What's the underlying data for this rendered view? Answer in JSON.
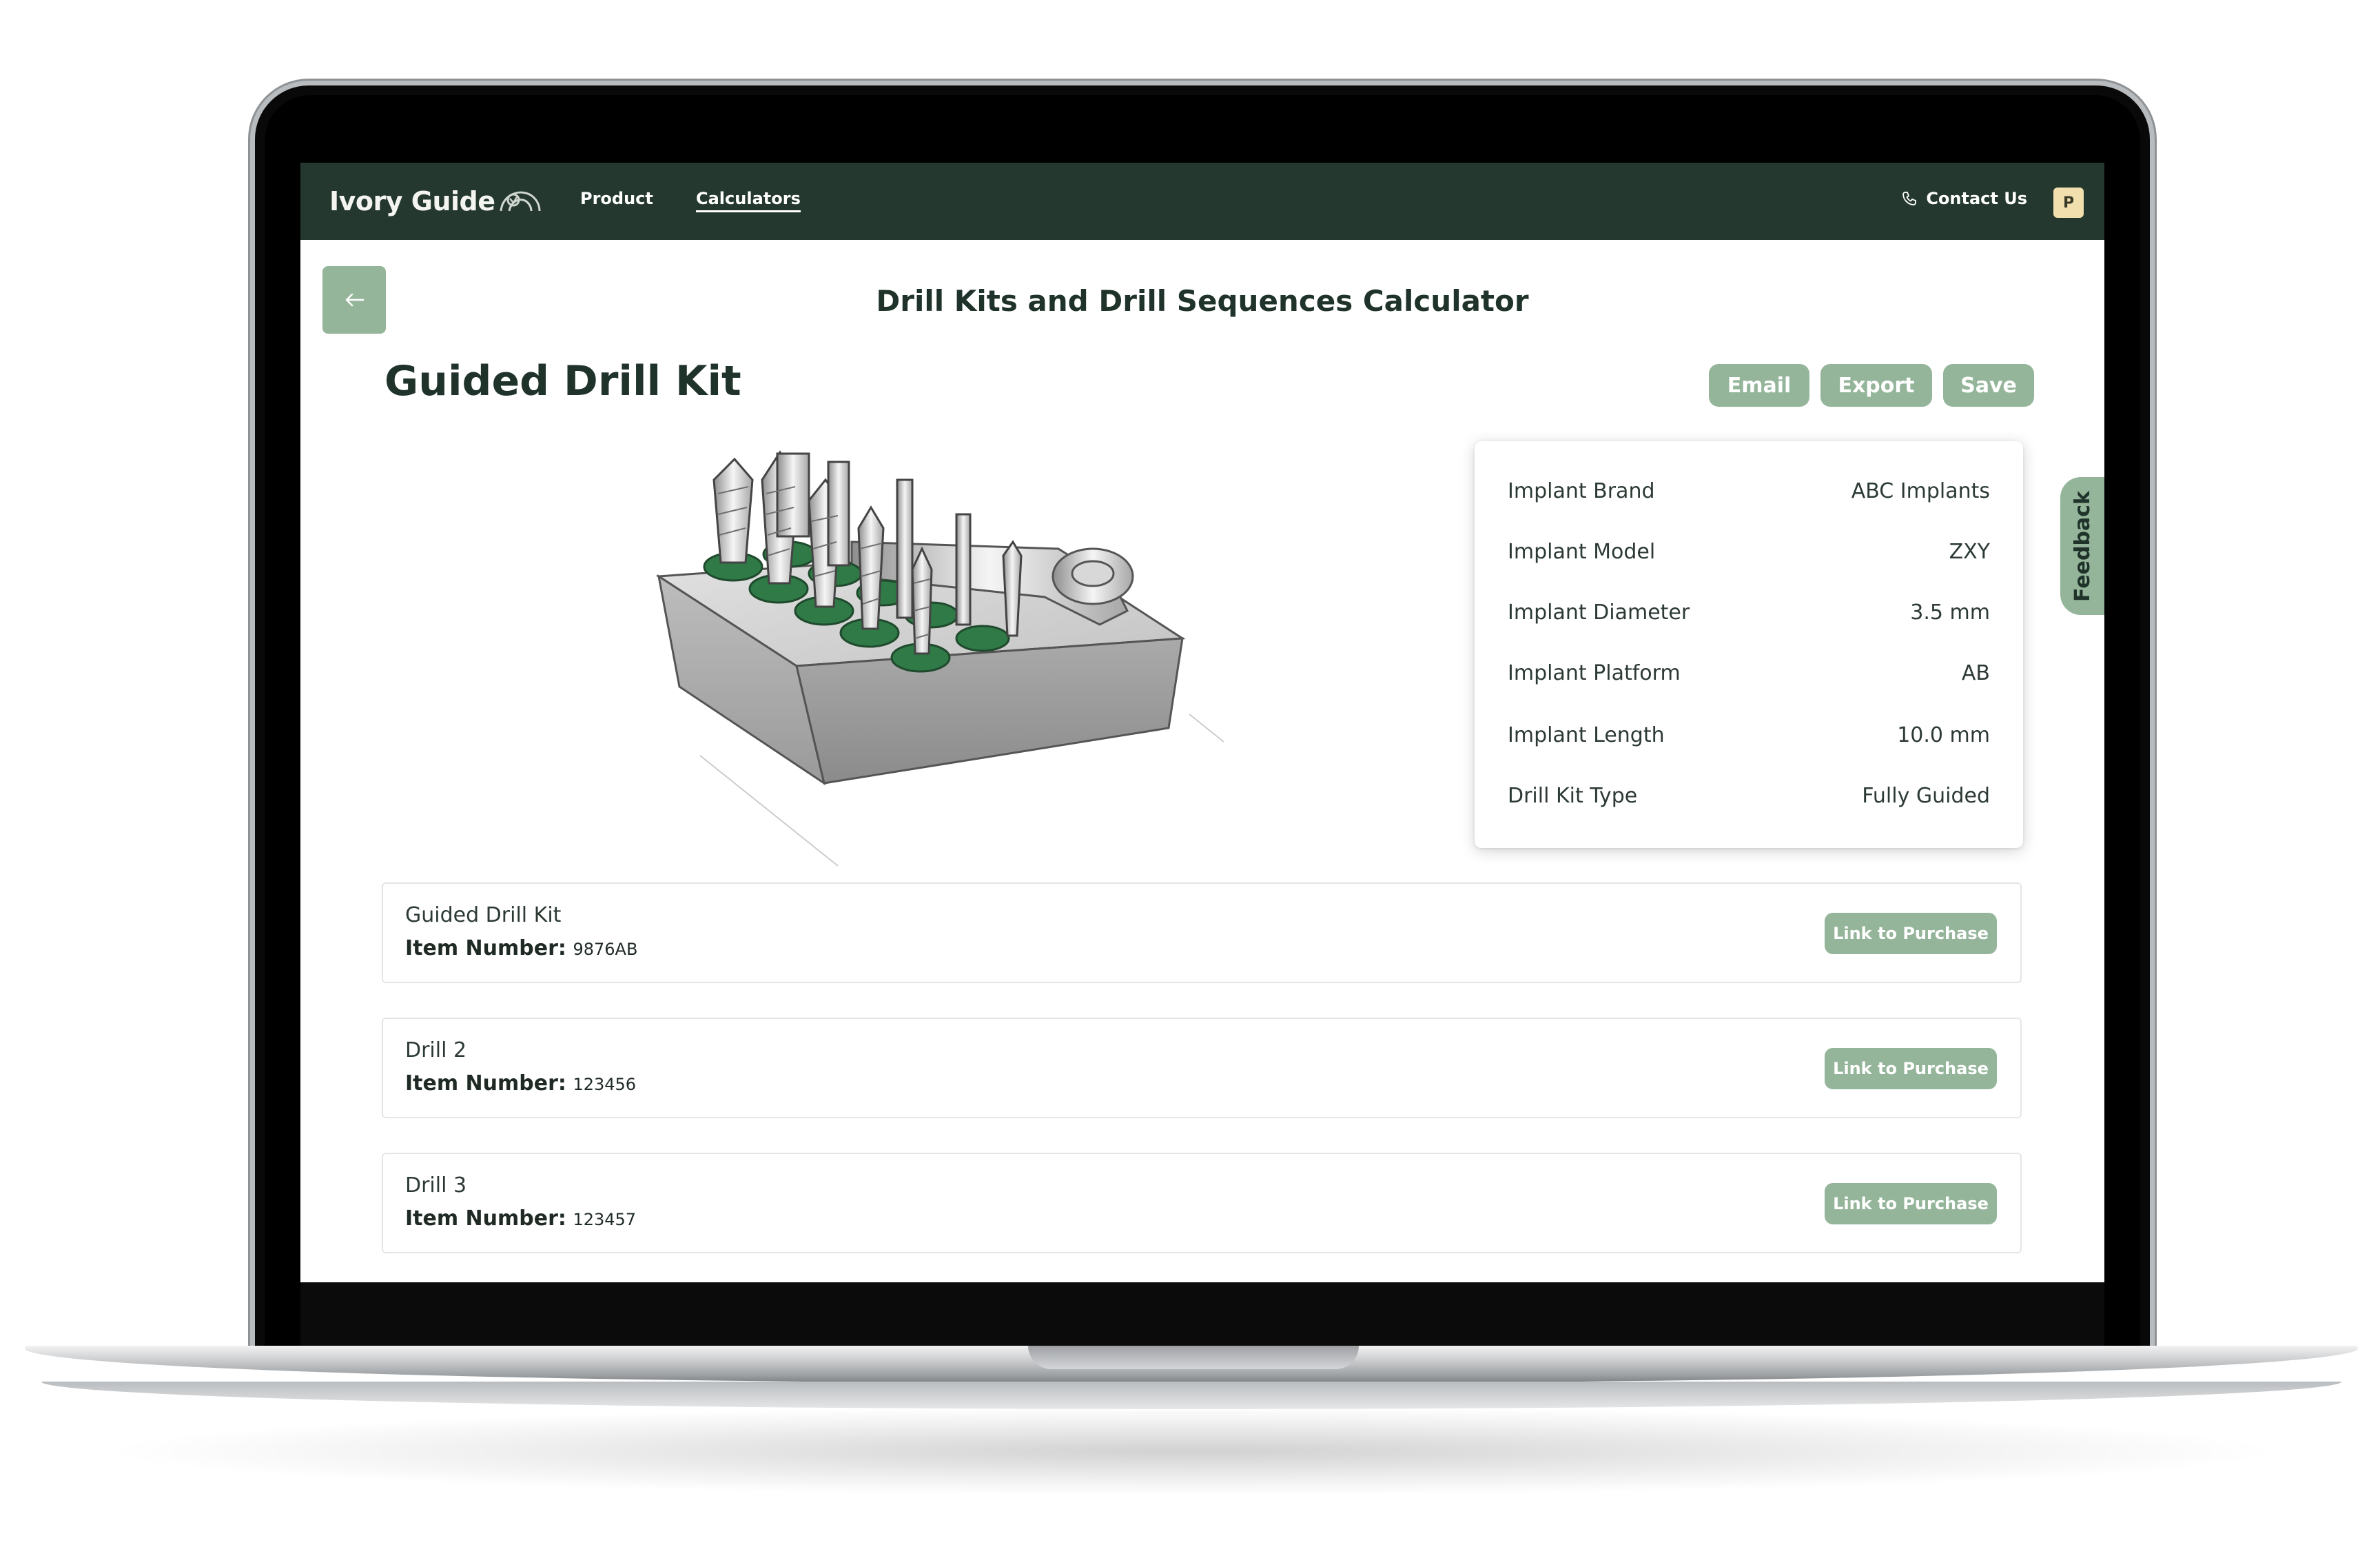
{
  "nav": {
    "brand": "Ivory Guide",
    "links": [
      "Product",
      "Calculators"
    ],
    "contact_label": "Contact Us",
    "avatar_initial": "P"
  },
  "page": {
    "heading": "Drill Kits and Drill Sequences Calculator",
    "section_title": "Guided Drill Kit",
    "actions": [
      "Email",
      "Export",
      "Save"
    ]
  },
  "specs": [
    {
      "label": "Implant Brand",
      "value": "ABC Implants"
    },
    {
      "label": "Implant Model",
      "value": "ZXY"
    },
    {
      "label": "Implant Diameter",
      "value": "3.5 mm"
    },
    {
      "label": "Implant Platform",
      "value": "AB"
    },
    {
      "label": "Implant Length",
      "value": "10.0 mm"
    },
    {
      "label": "Drill Kit Type",
      "value": "Fully Guided"
    }
  ],
  "feedback_label": "Feedback",
  "items": [
    {
      "name": "Guided Drill Kit",
      "number_label": "Item Number:",
      "number": "9876AB",
      "button": "Link to Purchase"
    },
    {
      "name": "Drill 2",
      "number_label": "Item Number:",
      "number": "123456",
      "button": "Link to Purchase"
    },
    {
      "name": "Drill 3",
      "number_label": "Item Number:",
      "number": "123457",
      "button": "Link to Purchase"
    }
  ],
  "colors": {
    "navbar": "#24382f",
    "accent": "#94b59a",
    "heading": "#1f332a",
    "avatar": "#f1e0ad"
  }
}
